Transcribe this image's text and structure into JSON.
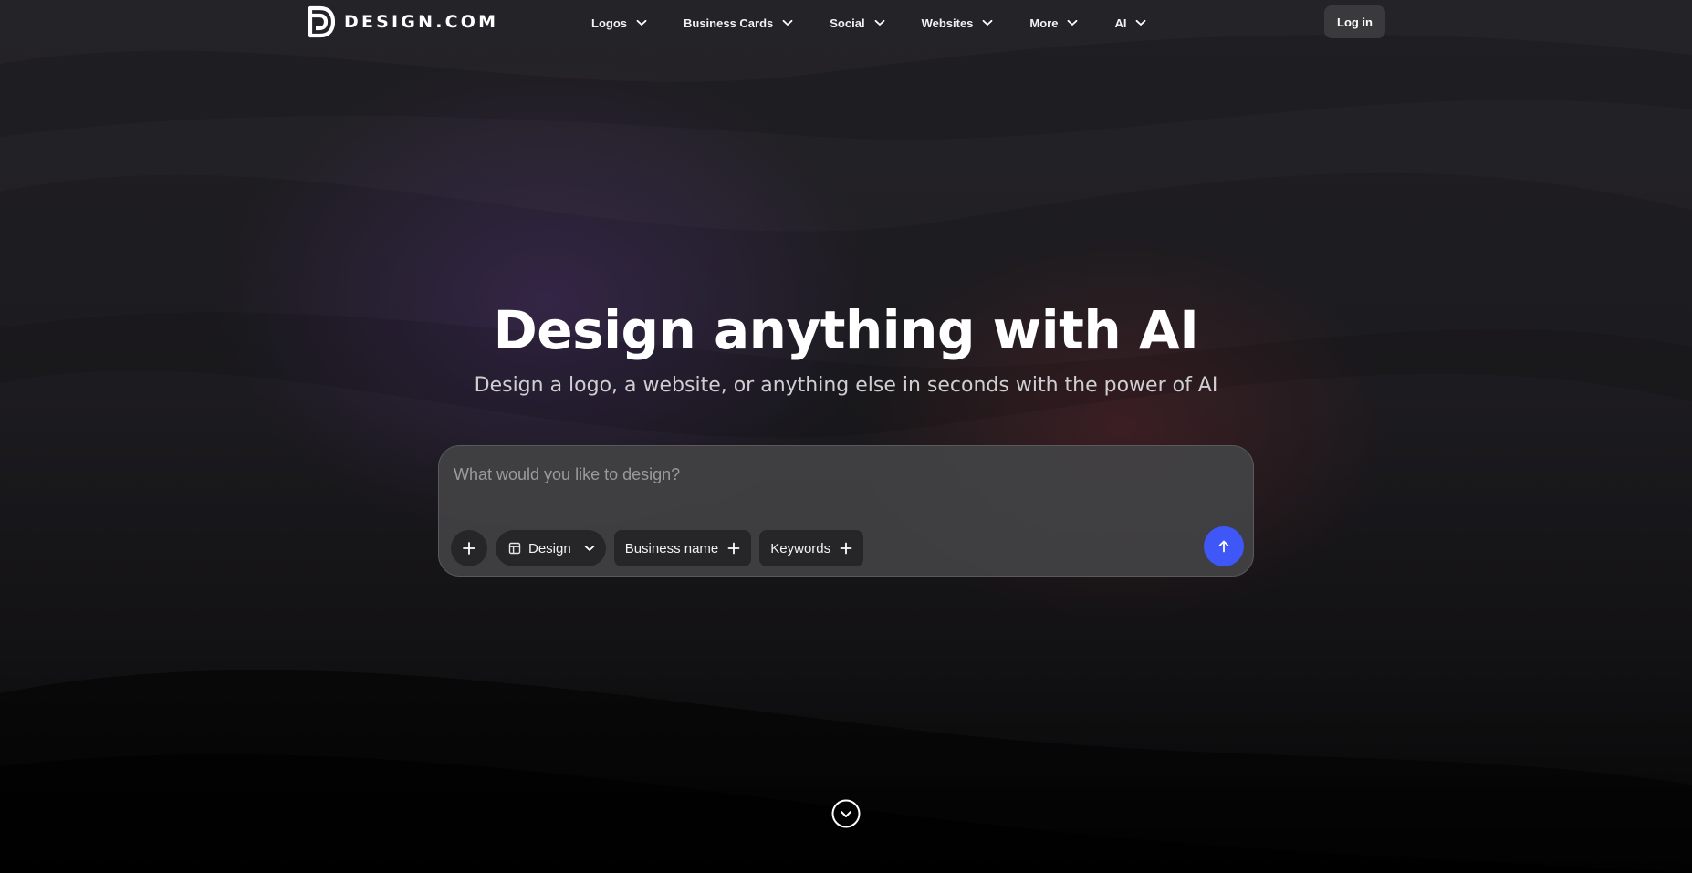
{
  "header": {
    "logo_text": "DESIGN.COM",
    "nav": [
      {
        "label": "Logos"
      },
      {
        "label": "Business Cards"
      },
      {
        "label": "Social"
      },
      {
        "label": "Websites"
      },
      {
        "label": "More"
      },
      {
        "label": "AI"
      }
    ],
    "login_label": "Log in"
  },
  "hero": {
    "title": "Design anything with AI",
    "subtitle": "Design a logo, a website, or anything else in seconds with the power of AI"
  },
  "prompt": {
    "placeholder": "What would you like to design?",
    "value": "",
    "design_label": "Design",
    "business_name_label": "Business name",
    "keywords_label": "Keywords"
  },
  "icons": {
    "logo": "design-com-logo-icon",
    "nav_chevron": "chevron-down-icon",
    "add": "plus-icon",
    "design_type": "layout-template-icon",
    "submit": "arrow-up-icon",
    "scroll": "circle-chevron-down-icon"
  },
  "colors": {
    "background": "#1c1b1f",
    "accent": "#3f57f6",
    "prompt_box": "#424244",
    "pill": "#262628",
    "login_button": "#3a3a3c"
  }
}
